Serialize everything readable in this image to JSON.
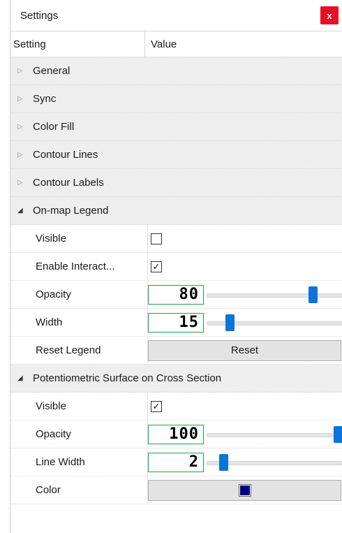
{
  "window": {
    "title": "Settings",
    "close_label": "x"
  },
  "grid": {
    "col_setting": "Setting",
    "col_value": "Value"
  },
  "categories": {
    "general": "General",
    "sync": "Sync",
    "color_fill": "Color Fill",
    "contour_lines": "Contour Lines",
    "contour_labels": "Contour Labels",
    "legend": "On-map Legend",
    "potentiometric": "Potentiometric Surface on Cross Section"
  },
  "legend": {
    "visible_label": "Visible",
    "visible_checked": false,
    "interact_label": "Enable Interact...",
    "interact_checked": true,
    "opacity_label": "Opacity",
    "opacity_value": "80",
    "opacity_fraction": 0.8,
    "width_label": "Width",
    "width_value": "15",
    "width_fraction": 0.15,
    "reset_label": "Reset Legend",
    "reset_button": "Reset"
  },
  "potentiometric": {
    "visible_label": "Visible",
    "visible_checked": true,
    "opacity_label": "Opacity",
    "opacity_value": "100",
    "opacity_fraction": 1.0,
    "line_width_label": "Line Width",
    "line_width_value": "2",
    "line_width_fraction": 0.1,
    "color_label": "Color",
    "color_hex": "#000080"
  },
  "icons": {
    "collapsed": "triangle-right-icon",
    "expanded": "triangle-down-icon",
    "check": "check-icon"
  },
  "colors": {
    "accent": "#0a74da",
    "numbox_border": "#1aa34a",
    "close": "#e81123"
  }
}
